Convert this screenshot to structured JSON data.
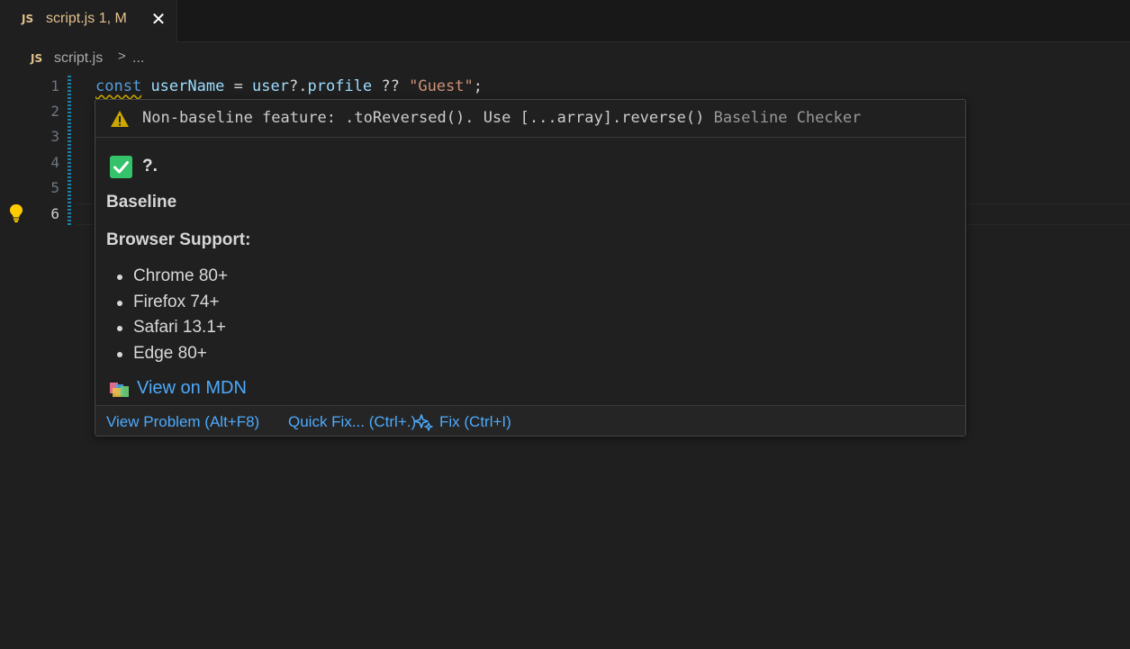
{
  "tab": {
    "badge": "JS",
    "name": "script.js",
    "status": "1, M",
    "close_glyph": "✕"
  },
  "breadcrumb": {
    "badge": "JS",
    "file": "script.js",
    "separator": ">",
    "more": "..."
  },
  "gutter": {
    "lines": [
      "1",
      "2",
      "3",
      "4",
      "5",
      "6"
    ],
    "active_line": "6"
  },
  "code": {
    "line1": {
      "keyword": "const",
      "var": "userName",
      "eq": " = ",
      "obj": "user",
      "op1": "?.",
      "prop": "profile",
      "op2": " ?? ",
      "str": "\"Guest\"",
      "end": ";"
    }
  },
  "hover": {
    "warning_message": "Non-baseline feature: .toReversed(). Use [...array].reverse()",
    "warning_source": "Baseline Checker",
    "feature_name": "?.",
    "status": "Baseline",
    "support_heading": "Browser Support:",
    "browsers": [
      "Chrome 80+",
      "Firefox 74+",
      "Safari 13.1+",
      "Edge 80+"
    ],
    "mdn_link": "View on MDN",
    "actions": {
      "view_problem": "View Problem (Alt+F8)",
      "quick_fix": "Quick Fix... (Ctrl+.)",
      "fix": "Fix (Ctrl+I)"
    }
  },
  "colors": {
    "keyword": "#569cd6",
    "variable": "#9cdcfe",
    "string": "#ce9178",
    "warning": "#cca700",
    "link": "#4daafc",
    "tab_modified": "#e2c08d"
  },
  "icons": [
    "close-icon",
    "lightbulb-icon",
    "warning-icon",
    "check-icon",
    "mdn-icon",
    "sparkle-icon"
  ]
}
